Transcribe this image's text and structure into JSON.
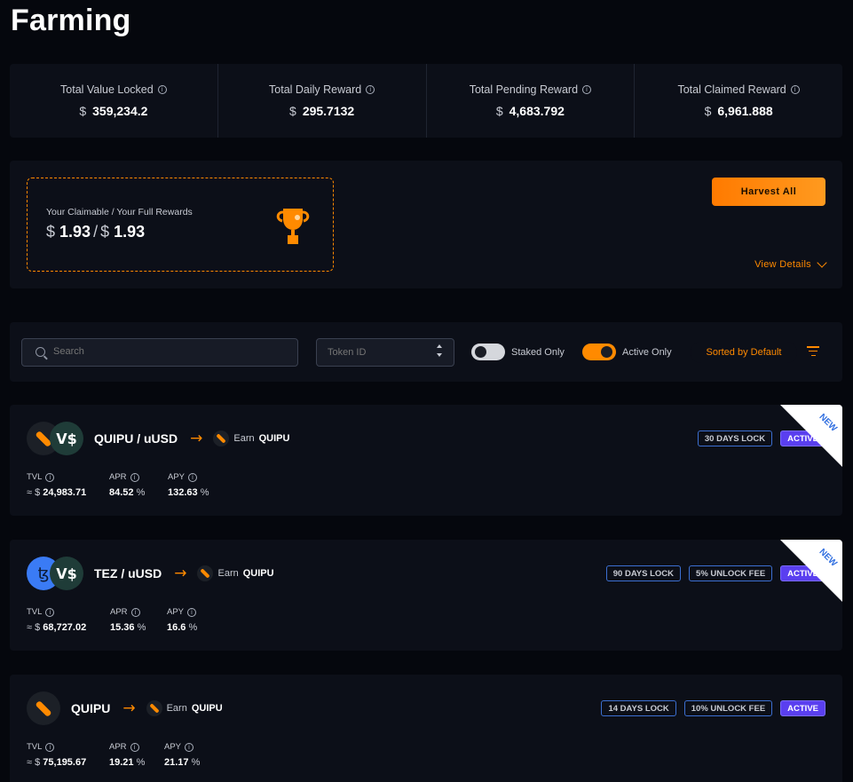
{
  "page": {
    "title": "Farming"
  },
  "stats": [
    {
      "label": "Total Value Locked",
      "currency": "$",
      "value": "359,234.2"
    },
    {
      "label": "Total Daily Reward",
      "currency": "$",
      "value": "295.7132"
    },
    {
      "label": "Total Pending Reward",
      "currency": "$",
      "value": "4,683.792"
    },
    {
      "label": "Total Claimed Reward",
      "currency": "$",
      "value": "6,961.888"
    }
  ],
  "rewards": {
    "label": "Your Claimable / Your Full Rewards",
    "currency": "$",
    "claimable": "1.93",
    "separator": "/",
    "full": "1.93",
    "harvest_label": "Harvest All",
    "details_label": "View Details"
  },
  "filters": {
    "search_placeholder": "Search",
    "token_placeholder": "Token ID",
    "staked_label": "Staked Only",
    "staked_on": false,
    "active_label": "Active Only",
    "active_on": true,
    "sort_label": "Sorted by Default"
  },
  "farms": [
    {
      "pair": "QUIPU / uUSD",
      "earn_prefix": "Earn",
      "earn_token": "QUIPU",
      "badges": [
        "30 DAYS LOCK"
      ],
      "status": "ACTIVE",
      "ribbon": "NEW",
      "tvl_label": "TVL",
      "tvl_prefix": "≈ $",
      "tvl": "24,983.71",
      "apr_label": "APR",
      "apr": "84.52",
      "apr_unit": "%",
      "apy_label": "APY",
      "apy": "132.63",
      "apy_unit": "%"
    },
    {
      "pair": "TEZ / uUSD",
      "earn_prefix": "Earn",
      "earn_token": "QUIPU",
      "badges": [
        "90 DAYS LOCK",
        "5% UNLOCK FEE"
      ],
      "status": "ACTIVE",
      "ribbon": "NEW",
      "tvl_label": "TVL",
      "tvl_prefix": "≈ $",
      "tvl": "68,727.02",
      "apr_label": "APR",
      "apr": "15.36",
      "apr_unit": "%",
      "apy_label": "APY",
      "apy": "16.6",
      "apy_unit": "%"
    },
    {
      "pair": "QUIPU",
      "earn_prefix": "Earn",
      "earn_token": "QUIPU",
      "badges": [
        "14 DAYS LOCK",
        "10% UNLOCK FEE"
      ],
      "status": "ACTIVE",
      "tvl_label": "TVL",
      "tvl_prefix": "≈ $",
      "tvl": "75,195.67",
      "apr_label": "APR",
      "apr": "19.21",
      "apr_unit": "%",
      "apy_label": "APY",
      "apy": "21.17",
      "apy_unit": "%"
    }
  ],
  "icons": {
    "info": "info-icon",
    "trophy": "trophy-icon",
    "search": "search-icon",
    "filter": "filter-icon",
    "arrow": "arrow-right-icon",
    "quipu": "quipu-token-icon",
    "uusd": "uusd-token-icon",
    "tez": "tez-token-icon"
  },
  "colors": {
    "accent": "#ff8a00",
    "active": "#5a3ff0",
    "badge_border": "#3c6fd1",
    "background": "#05070d",
    "card": "#0c0f18"
  }
}
